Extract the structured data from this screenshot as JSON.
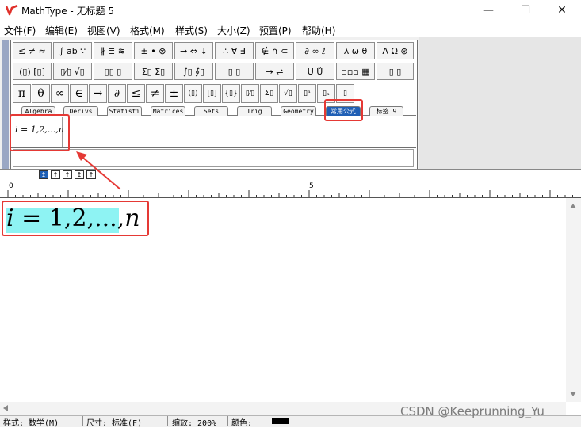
{
  "window": {
    "title": "MathType - 无标题 5",
    "app_logo_color": "#e0302a",
    "minimize": "—",
    "maximize": "☐",
    "close": "✕"
  },
  "menu": [
    "文件(F)",
    "编辑(E)",
    "视图(V)",
    "格式(M)",
    "样式(S)",
    "大小(Z)",
    "预置(P)",
    "帮助(H)"
  ],
  "palette": {
    "row1": [
      "≤ ≠ ≈",
      "∫ ab ∵",
      "∦ ≣ ≋",
      "± • ⊗",
      "→ ⇔ ↓",
      "∴ ∀ ∃",
      "∉ ∩ ⊂",
      "∂ ∞ ℓ",
      "λ ω θ",
      "Λ Ω ⊛"
    ],
    "row2": [
      "(▯) [▯]",
      "▯⁄▯ √▯",
      "▯▯ ▯",
      "Σ▯ Σ▯",
      "∫▯ ∮▯",
      "▯ ▯",
      "→ ⇌",
      "Ū Ů",
      "▫▫▫ ▦",
      "▯ ▯"
    ],
    "symbols": [
      "π",
      "θ",
      "∞",
      "∈",
      "→",
      "∂",
      "≤",
      "≠",
      "±",
      "(▯)",
      "[▯]",
      "{▯}",
      "▯⁄▯",
      "Σ▯",
      "√▯",
      "▯ⁿ",
      "▯ₙ",
      "▯"
    ],
    "tabs": [
      "Algebra",
      "Derivs",
      "Statisti",
      "Matrices",
      "Sets",
      "Trig",
      "Geometry",
      "常用公式",
      "标签 9"
    ],
    "active_tab": "常用公式",
    "saved_expression": "i = 1,2,...,n"
  },
  "nudge_buttons": [
    "↥",
    "↑",
    "↑",
    "↥",
    "↑"
  ],
  "ruler": {
    "label_0": "0",
    "label_5": "5"
  },
  "document": {
    "formula": "i = 1,2,...,n",
    "highlight_color": "#8ef3f3"
  },
  "status": {
    "style": "样式: 数学(M)",
    "size": "尺寸: 标准(F)",
    "zoom": "缩放: 200%",
    "color_label": "颜色:",
    "color_value": "#000000"
  },
  "watermark": "CSDN @Keeprunning_Yu",
  "annotation_color": "#e53935"
}
